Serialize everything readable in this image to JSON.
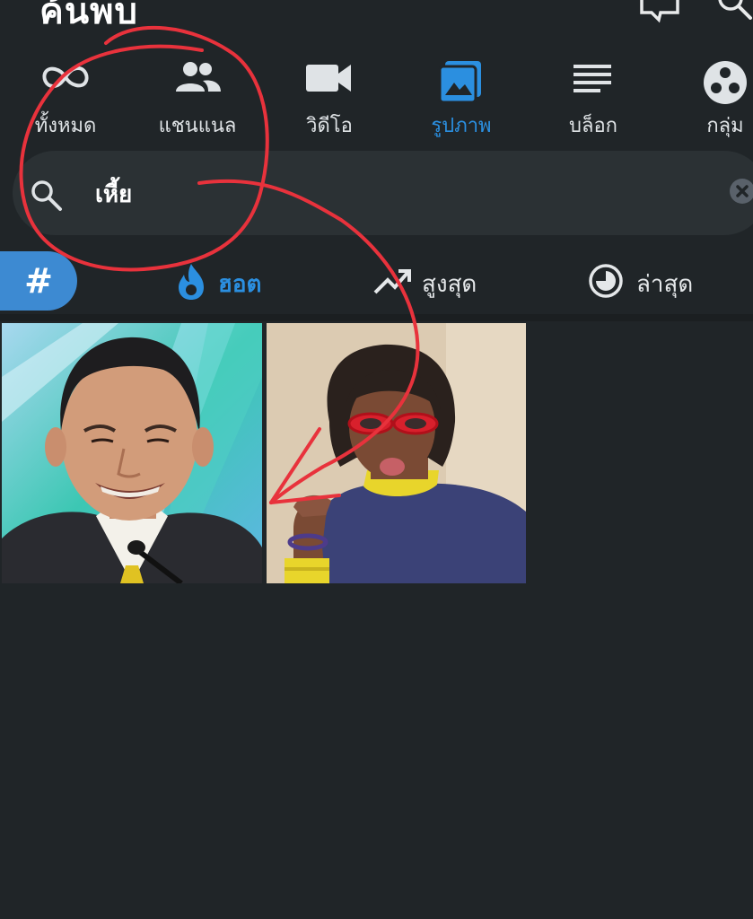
{
  "header": {
    "title": "ค้นพบ",
    "chat_icon": "chat-icon",
    "search_icon": "search-icon"
  },
  "tabs": [
    {
      "label": "ทั้งหมด",
      "icon": "infinity-icon",
      "active": false
    },
    {
      "label": "แชนแนล",
      "icon": "people-icon",
      "active": false
    },
    {
      "label": "วิดีโอ",
      "icon": "video-icon",
      "active": false
    },
    {
      "label": "รูปภาพ",
      "icon": "image-icon",
      "active": true
    },
    {
      "label": "บล็อก",
      "icon": "text-lines-icon",
      "active": false
    },
    {
      "label": "กลุ่ม",
      "icon": "group-icon",
      "active": false
    }
  ],
  "search": {
    "query": "เหี้ย",
    "icon": "search-icon",
    "clear_icon": "clear-icon"
  },
  "sort": {
    "hashtag_label": "#",
    "options": [
      {
        "label": "ฮอต",
        "icon": "flame-icon",
        "active": true
      },
      {
        "label": "สูงสุด",
        "icon": "trending-up-icon",
        "active": false
      },
      {
        "label": "ล่าสุด",
        "icon": "clock-icon",
        "active": false
      }
    ]
  },
  "results": [
    {
      "kind": "photo",
      "subject": "man-in-suit"
    },
    {
      "kind": "photo",
      "subject": "person-with-red-glasses"
    }
  ],
  "colors": {
    "background": "#202528",
    "accent": "#2b8fe0",
    "search_bg": "#2b3134",
    "hashtag_bg": "#3d8ad2",
    "annotation": "#e8323c"
  }
}
